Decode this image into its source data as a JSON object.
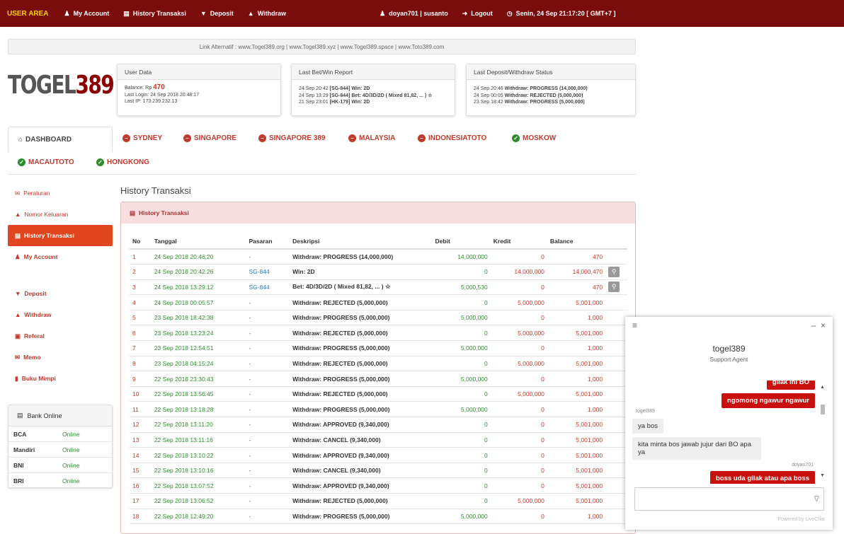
{
  "topbar": {
    "brand": "USER AREA",
    "nav": [
      {
        "label": "My Account",
        "icon": "user-icon"
      },
      {
        "label": "History Transaksi",
        "icon": "list-icon"
      },
      {
        "label": "Deposit",
        "icon": "deposit-icon"
      },
      {
        "label": "Withdraw",
        "icon": "withdraw-icon"
      }
    ],
    "user": "doyan701 | susanto",
    "logout": "Logout",
    "datetime": "Senin, 24 Sep 21:17:20 [ GMT+7 ]"
  },
  "alt_links": "Link Alternatif : www.Togel389.org | www.Togel389.xyz | www.Togel389.space | www.Toto389.com",
  "logo": {
    "part1": "TOGEL",
    "part2": "389"
  },
  "user_data": {
    "title": "User Data",
    "balance_label": "Balance: Rp",
    "balance": "470",
    "last_login": "Last Login: 24 Sep 2018 20:48:17",
    "last_ip": "Last IP: 173.239.232.13"
  },
  "last_bet": {
    "title": "Last Bet/Win Report",
    "rows": [
      {
        "time": "24 Sep 20:42",
        "text": "[SG-844] Win: 2D"
      },
      {
        "time": "24 Sep 13:29",
        "text": "[SG-844] Bet: 4D/3D/2D ( Mixed 81,82, ... ) ☆"
      },
      {
        "time": "21 Sep 23:01",
        "text": "[HK-179] Win: 2D"
      }
    ]
  },
  "last_deposit": {
    "title": "Last Deposit/Withdraw Status",
    "rows": [
      {
        "time": "24 Sep 20:46",
        "text": "Withdraw: PROGRESS (14,000,000)"
      },
      {
        "time": "24 Sep 00:05",
        "text": "Withdraw: REJECTED (5,000,000)"
      },
      {
        "time": "23 Sep 18:42",
        "text": "Withdraw: PROGRESS (5,000,000)"
      }
    ]
  },
  "tabs": {
    "dashboard": "DASHBOARD",
    "markets": [
      {
        "label": "SYDNEY",
        "status": "closed"
      },
      {
        "label": "SINGAPORE",
        "status": "closed"
      },
      {
        "label": "SINGAPORE 389",
        "status": "closed"
      },
      {
        "label": "MALAYSIA",
        "status": "closed"
      },
      {
        "label": "INDONESIATOTO",
        "status": "closed"
      },
      {
        "label": "MOSKOW",
        "status": "open"
      },
      {
        "label": "MACAUTOTO",
        "status": "open"
      },
      {
        "label": "HONGKONG",
        "status": "open"
      }
    ]
  },
  "sidebar": {
    "items": [
      {
        "label": "Peraturan",
        "icon": "megaphone-icon"
      },
      {
        "label": "Nomor Keluaran",
        "icon": "bell-icon"
      },
      {
        "label": "History Transaksi",
        "icon": "list-icon"
      },
      {
        "label": "My Account",
        "icon": "user-icon"
      },
      {
        "label": "Deposit",
        "icon": "deposit-icon"
      },
      {
        "label": "Withdraw",
        "icon": "withdraw-icon"
      },
      {
        "label": "Referal",
        "icon": "gift-icon"
      },
      {
        "label": "Memo",
        "icon": "envelope-icon"
      },
      {
        "label": "Buku Mimpi",
        "icon": "book-icon"
      }
    ]
  },
  "bank": {
    "title": "Bank Online",
    "rows": [
      {
        "name": "BCA",
        "status": "Online"
      },
      {
        "name": "Mandiri",
        "status": "Online"
      },
      {
        "name": "BNI",
        "status": "Online"
      },
      {
        "name": "BRI",
        "status": "Online"
      }
    ]
  },
  "page_title": "History Transaksi",
  "history": {
    "panel_title": "History Transaksi",
    "columns": [
      "No",
      "Tanggal",
      "Pasaran",
      "Deskripsi",
      "Debit",
      "Kredit",
      "Balance"
    ],
    "rows": [
      [
        "1",
        "24 Sep 2018 20:46:20",
        "-",
        "Withdraw: PROGRESS (14,000,000)",
        "14,000,000",
        "0",
        "470",
        ""
      ],
      [
        "2",
        "24 Sep 2018 20:42:26",
        "SG-844",
        "Win: 2D",
        "0",
        "14,000,000",
        "14,000,470",
        "zoom"
      ],
      [
        "3",
        "24 Sep 2018 13:29:12",
        "SG-844",
        "Bet: 4D/3D/2D ( Mixed 81,82, ... ) ☆",
        "5,000,530",
        "0",
        "470",
        "zoom"
      ],
      [
        "4",
        "24 Sep 2018 00:05:57",
        "-",
        "Withdraw: REJECTED (5,000,000)",
        "0",
        "5,000,000",
        "5,001,000",
        ""
      ],
      [
        "5",
        "23 Sep 2018 18:42:38",
        "-",
        "Withdraw: PROGRESS (5,000,000)",
        "5,000,000",
        "0",
        "1,000",
        ""
      ],
      [
        "6",
        "23 Sep 2018 13:23:24",
        "-",
        "Withdraw: REJECTED (5,000,000)",
        "0",
        "5,000,000",
        "5,001,000",
        ""
      ],
      [
        "7",
        "23 Sep 2018 12:54:51",
        "-",
        "Withdraw: PROGRESS (5,000,000)",
        "5,000,000",
        "0",
        "1,000",
        ""
      ],
      [
        "8",
        "23 Sep 2018 04:15:24",
        "-",
        "Withdraw: REJECTED (5,000,000)",
        "0",
        "5,000,000",
        "5,001,000",
        ""
      ],
      [
        "9",
        "22 Sep 2018 23:30:43",
        "-",
        "Withdraw: PROGRESS (5,000,000)",
        "5,000,000",
        "0",
        "1,000",
        ""
      ],
      [
        "10",
        "22 Sep 2018 13:56:45",
        "-",
        "Withdraw: REJECTED (5,000,000)",
        "0",
        "5,000,000",
        "5,001,000",
        ""
      ],
      [
        "11",
        "22 Sep 2018 13:18:28",
        "-",
        "Withdraw: PROGRESS (5,000,000)",
        "5,000,000",
        "0",
        "1,000",
        ""
      ],
      [
        "12",
        "22 Sep 2018 13:11:20",
        "-",
        "Withdraw: APPROVED (9,340,000)",
        "0",
        "0",
        "5,001,000",
        ""
      ],
      [
        "13",
        "22 Sep 2018 13:11:16",
        "-",
        "Withdraw: CANCEL (9,340,000)",
        "0",
        "0",
        "5,001,000",
        ""
      ],
      [
        "14",
        "22 Sep 2018 13:10:22",
        "-",
        "Withdraw: APPROVED (9,340,000)",
        "0",
        "0",
        "5,001,000",
        ""
      ],
      [
        "15",
        "22 Sep 2018 13:10:16",
        "-",
        "Withdraw: CANCEL (9,340,000)",
        "0",
        "0",
        "5,001,000",
        ""
      ],
      [
        "16",
        "22 Sep 2018 13:07:52",
        "-",
        "Withdraw: APPROVED (9,340,000)",
        "0",
        "0",
        "5,001,000",
        ""
      ],
      [
        "17",
        "22 Sep 2018 13:06:52",
        "-",
        "Withdraw: REJECTED (5,000,000)",
        "0",
        "5,000,000",
        "5,001,000",
        ""
      ],
      [
        "18",
        "22 Sep 2018 12:49:20",
        "-",
        "Withdraw: PROGRESS (5,000,000)",
        "5,000,000",
        "0",
        "1,000",
        ""
      ]
    ]
  },
  "chat": {
    "agent_name": "togel389",
    "agent_role": "Support Agent",
    "messages": [
      {
        "from": "user",
        "text": "gilak ini BO"
      },
      {
        "from": "user",
        "text": "ngomong ngawur ngawur"
      },
      {
        "from": "agent",
        "sender": "togel389",
        "text": "ya bos"
      },
      {
        "from": "agent",
        "text": "kita minta bos jawab jujur dari BO apa ya"
      },
      {
        "from": "user",
        "sender": "doyan701",
        "text": "boss uda gilak atau apa boss"
      }
    ],
    "powered": "Powered by LiveChat"
  }
}
